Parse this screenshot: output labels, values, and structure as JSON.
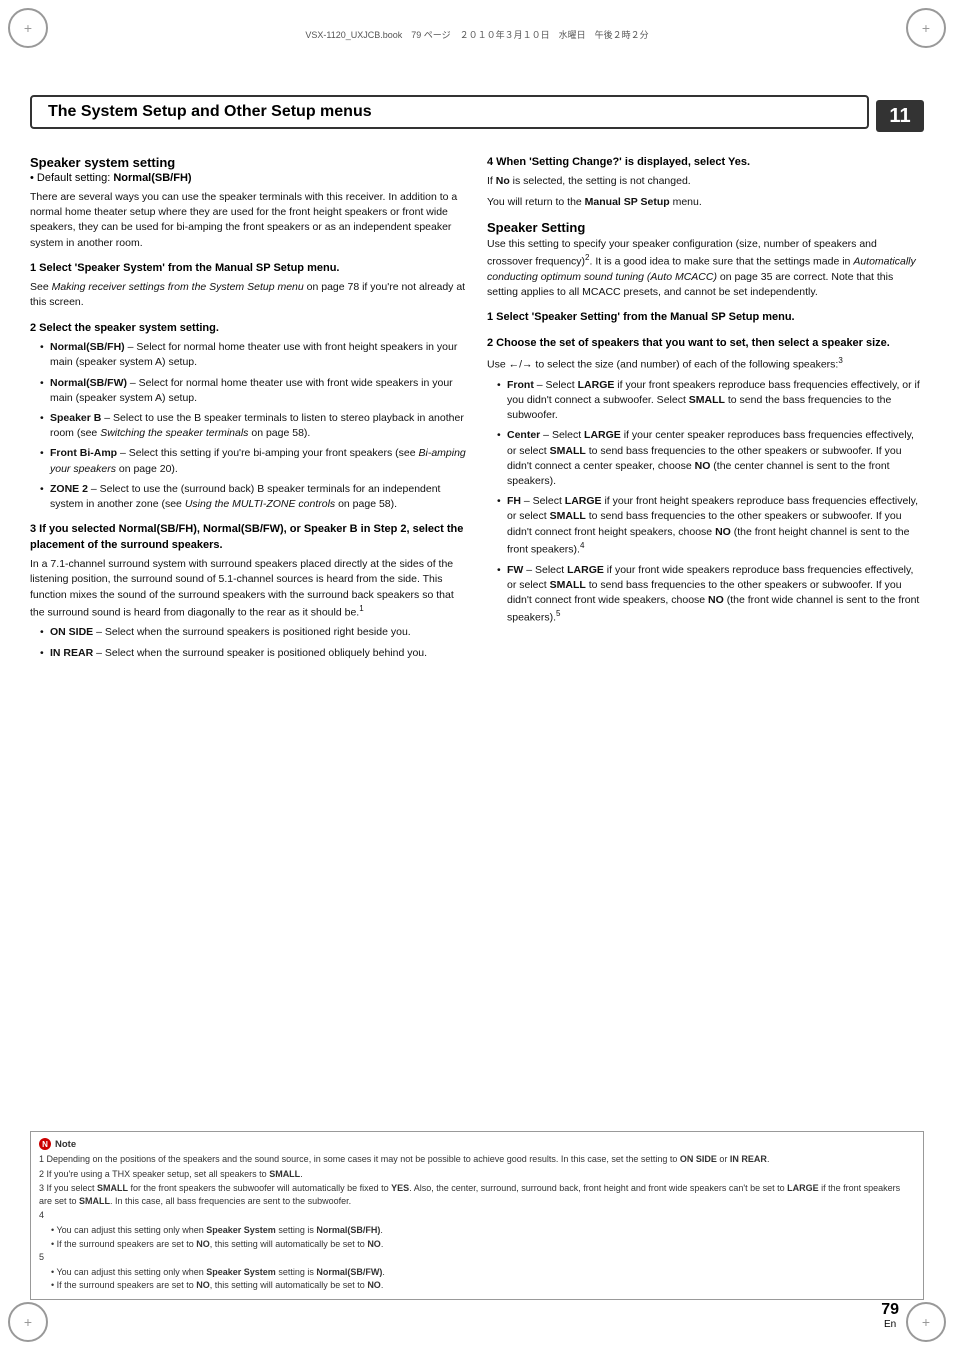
{
  "header": {
    "file_info": "VSX-1120_UXJCB.book　79 ページ　２０１０年３月１０日　水曜日　午後２時２分",
    "title": "The System Setup and Other Setup menus",
    "page_number": "11",
    "page_bottom": "79",
    "page_lang": "En"
  },
  "left_column": {
    "section1": {
      "title": "Speaker system setting",
      "subtitle_prefix": "• Default setting: ",
      "subtitle_value": "Normal(SB/FH)",
      "intro": "There are several ways you can use the speaker terminals with this receiver. In addition to a normal home theater setup where they are used for the front height speakers or front wide speakers, they can be used for bi-amping the front speakers or as an independent speaker system in another room.",
      "step1": {
        "heading": "1   Select 'Speaker System' from the Manual SP Setup menu.",
        "text": "See Making receiver settings from the System Setup menu on page 78 if you're not already at this screen."
      },
      "step2": {
        "heading": "2   Select the speaker system setting.",
        "bullets": [
          {
            "bold": "Normal(SB/FH)",
            "text": " – Select for normal home theater use with front height speakers in your main (speaker system A) setup."
          },
          {
            "bold": "Normal(SB/FW)",
            "text": " – Select for normal home theater use with front wide speakers in your main (speaker system A) setup."
          },
          {
            "bold": "Speaker B",
            "text": " – Select to use the B speaker terminals to listen to stereo playback in another room (see Switching the speaker terminals on page 58)."
          },
          {
            "bold": "Front Bi-Amp",
            "text": " – Select this setting if you're bi-amping your front speakers (see Bi-amping your speakers on page 20)."
          },
          {
            "bold": "ZONE 2",
            "text": " – Select to use the (surround back) B speaker terminals for an independent system in another zone (see Using the MULTI-ZONE controls on page 58)."
          }
        ]
      },
      "step3": {
        "heading": "3   If you selected Normal(SB/FH), Normal(SB/FW), or Speaker B in Step 2, select the placement of the surround speakers.",
        "text": "In a 7.1-channel surround system with surround speakers placed directly at the sides of the listening position, the surround sound of 5.1-channel sources is heard from the side. This function mixes the sound of the surround speakers with the surround back speakers so that the surround sound is heard from diagonally to the rear as it should be.",
        "sup": "1",
        "bullets": [
          {
            "bold": "ON SIDE",
            "text": " – Select when the surround speakers is positioned right beside you."
          },
          {
            "bold": "IN REAR",
            "text": " – Select when the surround speaker is positioned obliquely behind you."
          }
        ]
      }
    }
  },
  "right_column": {
    "step4": {
      "heading": "4   When 'Setting Change?' is displayed, select Yes.",
      "text1": "If No is selected, the setting is not changed.",
      "text2": "You will return to the Manual SP Setup menu."
    },
    "section2": {
      "title": "Speaker Setting",
      "intro": "Use this setting to specify your speaker configuration (size, number of speakers and crossover frequency)",
      "sup": "2",
      "intro2": ". It is a good idea to make sure that the settings made in Automatically conducting optimum sound tuning (Auto MCACC) on page 35 are correct. Note that this setting applies to all MCACC presets, and cannot be set independently.",
      "step1": {
        "heading": "1   Select 'Speaker Setting' from the Manual SP Setup menu."
      },
      "step2": {
        "heading": "2   Choose the set of speakers that you want to set, then select a speaker size.",
        "text": "Use ←/→ to select the size (and number) of each of the following speakers:",
        "sup": "3",
        "bullets": [
          {
            "bold": "Front",
            "text": " – Select LARGE if your front speakers reproduce bass frequencies effectively, or if you didn't connect a subwoofer. Select SMALL to send the bass frequencies to the subwoofer."
          },
          {
            "bold": "Center",
            "text": " – Select LARGE if your center speaker reproduces bass frequencies effectively, or select SMALL to send bass frequencies to the other speakers or subwoofer. If you didn't connect a center speaker, choose NO (the center channel is sent to the front speakers)."
          },
          {
            "bold": "FH",
            "text": " – Select LARGE if your front height speakers reproduce bass frequencies effectively, or select SMALL to send bass frequencies to the other speakers or subwoofer. If you didn't connect front height speakers, choose NO (the front height channel is sent to the front speakers).",
            "sup": "4"
          },
          {
            "bold": "FW",
            "text": " – Select LARGE if your front wide speakers reproduce bass frequencies effectively, or select SMALL to send bass frequencies to the other speakers or subwoofer. If you didn't connect front wide speakers, choose NO (the front wide channel is sent to the front speakers).",
            "sup": "5"
          }
        ]
      }
    }
  },
  "notes": {
    "title": "Note",
    "items": [
      {
        "number": "1",
        "text": "Depending on the positions of the speakers and the sound source, in some cases it may not be possible to achieve good results. In this case, set the setting to ON SIDE or IN REAR."
      },
      {
        "number": "2",
        "text": "If you're using a THX speaker setup, set all speakers to SMALL."
      },
      {
        "number": "3",
        "text": "If you select SMALL for the front speakers the subwoofer will automatically be fixed to YES. Also, the center, surround, surround back, front height and front wide speakers can't be set to LARGE if the front speakers are set to SMALL. In this case, all bass frequencies are sent to the subwoofer."
      },
      {
        "number": "4",
        "sub": [
          "• You can adjust this setting only when Speaker System setting is Normal(SB/FH).",
          "• If the surround speakers are set to NO, this setting will automatically be set to NO."
        ]
      },
      {
        "number": "5",
        "sub": [
          "• You can adjust this setting only when Speaker System setting is Normal(SB/FW).",
          "• If the surround speakers are set to NO, this setting will automatically be set to NO."
        ]
      }
    ]
  }
}
